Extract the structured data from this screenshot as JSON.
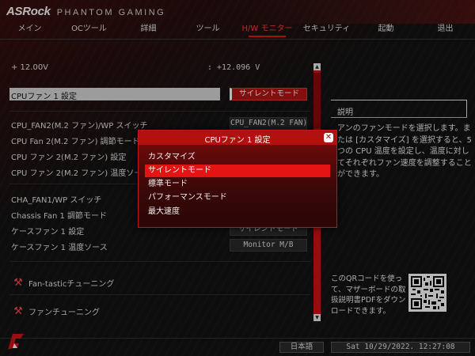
{
  "header": {
    "brand": "ASRock",
    "subtitle": "PHANTOM GAMING"
  },
  "nav": {
    "items": [
      {
        "label": "メイン"
      },
      {
        "label": "OCツール"
      },
      {
        "label": "詳細"
      },
      {
        "label": "ツール"
      },
      {
        "label": "H/W モニター"
      },
      {
        "label": "セキュリティ"
      },
      {
        "label": "起動"
      },
      {
        "label": "退出"
      }
    ],
    "active": "H/W モニター"
  },
  "settings": {
    "voltage_label": "+ 12.00V",
    "voltage_value": ": +12.096 V",
    "rows": [
      {
        "label": "CPUファン 1 設定",
        "value": "サイレントモード"
      },
      {
        "label": "CPU_FAN2(M.2 ファン)/WP スイッチ",
        "value": "CPU_FAN2(M.2 FAN)"
      },
      {
        "label": "CPU Fan 2(M.2 ファン) 調節モード",
        "value": ""
      },
      {
        "label": "CPU ファン 2(M.2 ファン) 設定",
        "value": ""
      },
      {
        "label": "CPU ファン 2(M.2 ファン) 温度ソース",
        "value": ""
      },
      {
        "label": "CHA_FAN1/WP スイッチ",
        "value": ""
      },
      {
        "label": "Chassis Fan 1 調節モード",
        "value": ""
      },
      {
        "label": "ケースファン 1 設定",
        "value": "サイレントモード"
      },
      {
        "label": "ケースファン 1 温度ソース",
        "value": "Monitor M/B"
      }
    ]
  },
  "tools": {
    "items": [
      {
        "label": "Fan-tasticチューニング",
        "icon": "tools-icon"
      },
      {
        "label": "ファンチューニング",
        "icon": "tools-icon"
      }
    ]
  },
  "description": {
    "title": "説明",
    "body": "アンのファンモードを選択します。または [カスタマイズ] を選択すると、5 つの CPU 温度を設定し、温度に対してそれぞれファン速度を調整することができます。"
  },
  "qr": {
    "text": "このQRコードを使って、マザーボードの取扱説明書PDFをダウンロードできます。"
  },
  "footer": {
    "language": "日本語",
    "datetime": "Sat 10/29/2022. 12:27:08"
  },
  "modal": {
    "title": "CPUファン 1 設定",
    "close_symbol": "✕",
    "options": [
      {
        "label": "カスタマイズ"
      },
      {
        "label": "サイレントモード"
      },
      {
        "label": "標準モード"
      },
      {
        "label": "パフォーマンスモード"
      },
      {
        "label": "最大速度"
      }
    ],
    "selected": "サイレントモード"
  },
  "colors": {
    "accent": "#e21818",
    "selected_option": "#e51414",
    "background": "#121212"
  }
}
